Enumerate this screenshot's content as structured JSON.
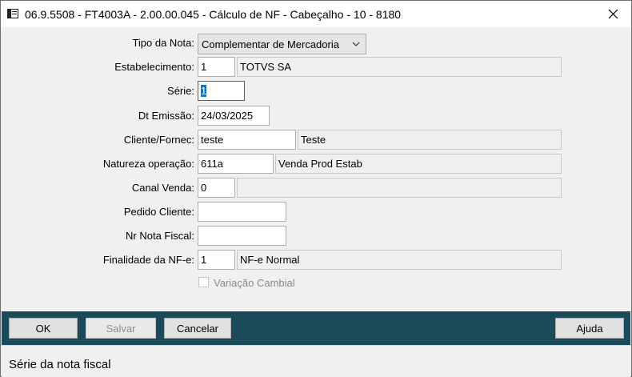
{
  "window": {
    "title": "06.9.5508 - FT4003A - 2.00.00.045 - Cálculo de NF - Cabeçalho - 10 - 8180",
    "close_icon": "close-icon"
  },
  "form": {
    "tipo_nota": {
      "label": "Tipo da Nota:",
      "value": "Complementar de Mercadoria"
    },
    "estabelecimento": {
      "label": "Estabelecimento:",
      "code": "1",
      "name": "TOTVS SA"
    },
    "serie": {
      "label": "Série:",
      "value": "1"
    },
    "dt_emissao": {
      "label": "Dt Emissão:",
      "value": "24/03/2025"
    },
    "cliente": {
      "label": "Cliente/Fornec:",
      "code": "teste",
      "name": "Teste"
    },
    "natureza": {
      "label": "Natureza operação:",
      "code": "611a",
      "name": "Venda Prod Estab"
    },
    "canal_venda": {
      "label": "Canal Venda:",
      "code": "0",
      "name": ""
    },
    "pedido_cliente": {
      "label": "Pedido Cliente:",
      "value": ""
    },
    "nr_nota_fiscal": {
      "label": "Nr Nota Fiscal:",
      "value": ""
    },
    "finalidade": {
      "label": "Finalidade da NF-e:",
      "code": "1",
      "name": "NF-e Normal"
    },
    "variacao_cambial": {
      "label": "Variação Cambial",
      "checked": false,
      "enabled": false
    }
  },
  "buttons": {
    "ok": "OK",
    "salvar": "Salvar",
    "cancelar": "Cancelar",
    "ajuda": "Ajuda"
  },
  "status": "Série da nota fiscal",
  "colors": {
    "button_bar": "#1b4a5b",
    "focus": "#0078d7",
    "background": "#f0f0f0"
  }
}
